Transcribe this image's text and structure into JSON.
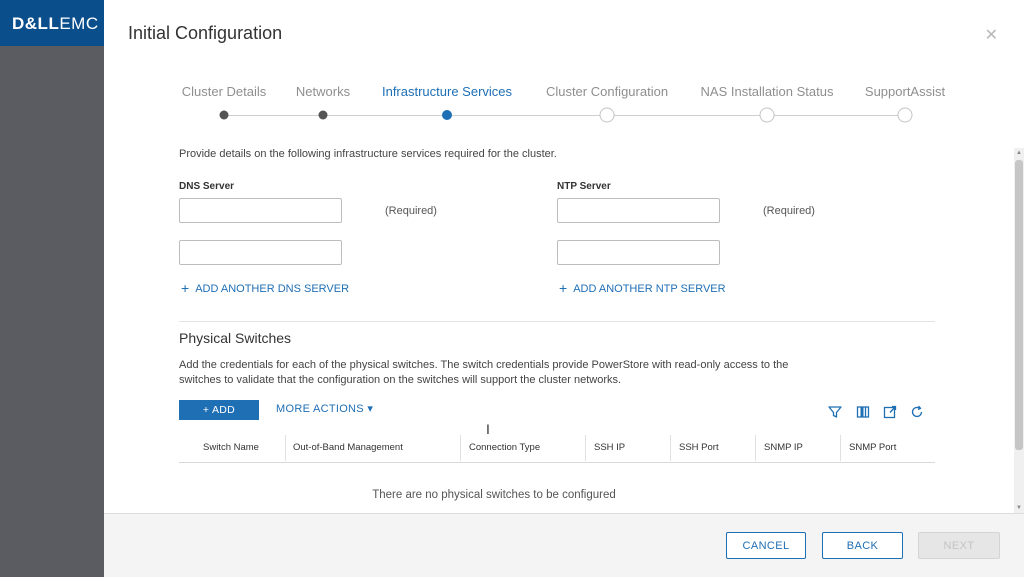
{
  "app": {
    "logo_bold": "D&LL",
    "logo_thin": "EMC"
  },
  "modal": {
    "title": "Initial Configuration",
    "close_icon": "close-icon"
  },
  "stepper": {
    "steps": [
      {
        "label": "Cluster Details",
        "state": "done"
      },
      {
        "label": "Networks",
        "state": "done"
      },
      {
        "label": "Infrastructure Services",
        "state": "active"
      },
      {
        "label": "Cluster Configuration",
        "state": "todo"
      },
      {
        "label": "NAS Installation Status",
        "state": "todo"
      },
      {
        "label": "SupportAssist",
        "state": "todo"
      }
    ]
  },
  "infra": {
    "description": "Provide details on the following infrastructure services required for the cluster.",
    "dns": {
      "label": "DNS Server",
      "field1_value": "",
      "field2_value": "",
      "required_text": "(Required)",
      "add_label": "ADD ANOTHER DNS SERVER"
    },
    "ntp": {
      "label": "NTP Server",
      "field1_value": "",
      "field2_value": "",
      "required_text": "(Required)",
      "add_label": "ADD ANOTHER NTP SERVER"
    }
  },
  "switches": {
    "title": "Physical Switches",
    "description": "Add the credentials for each of the physical switches. The switch credentials provide PowerStore with read-only access to the switches to validate that the configuration on the switches will support the cluster networks.",
    "add_label": "ADD",
    "more_actions_label": "MORE ACTIONS",
    "toolbar_icons": [
      "filter-icon",
      "columns-icon",
      "export-icon",
      "refresh-icon"
    ],
    "columns": [
      "Switch Name",
      "Out-of-Band Management",
      "Connection Type",
      "SSH IP",
      "SSH Port",
      "SNMP IP",
      "SNMP Port"
    ],
    "empty_message": "There are no physical switches to be configured"
  },
  "footer": {
    "cancel_label": "CANCEL",
    "back_label": "BACK",
    "next_label": "NEXT"
  },
  "colors": {
    "accent": "#1f6fb5",
    "brand_bar": "#0a4e8c"
  }
}
